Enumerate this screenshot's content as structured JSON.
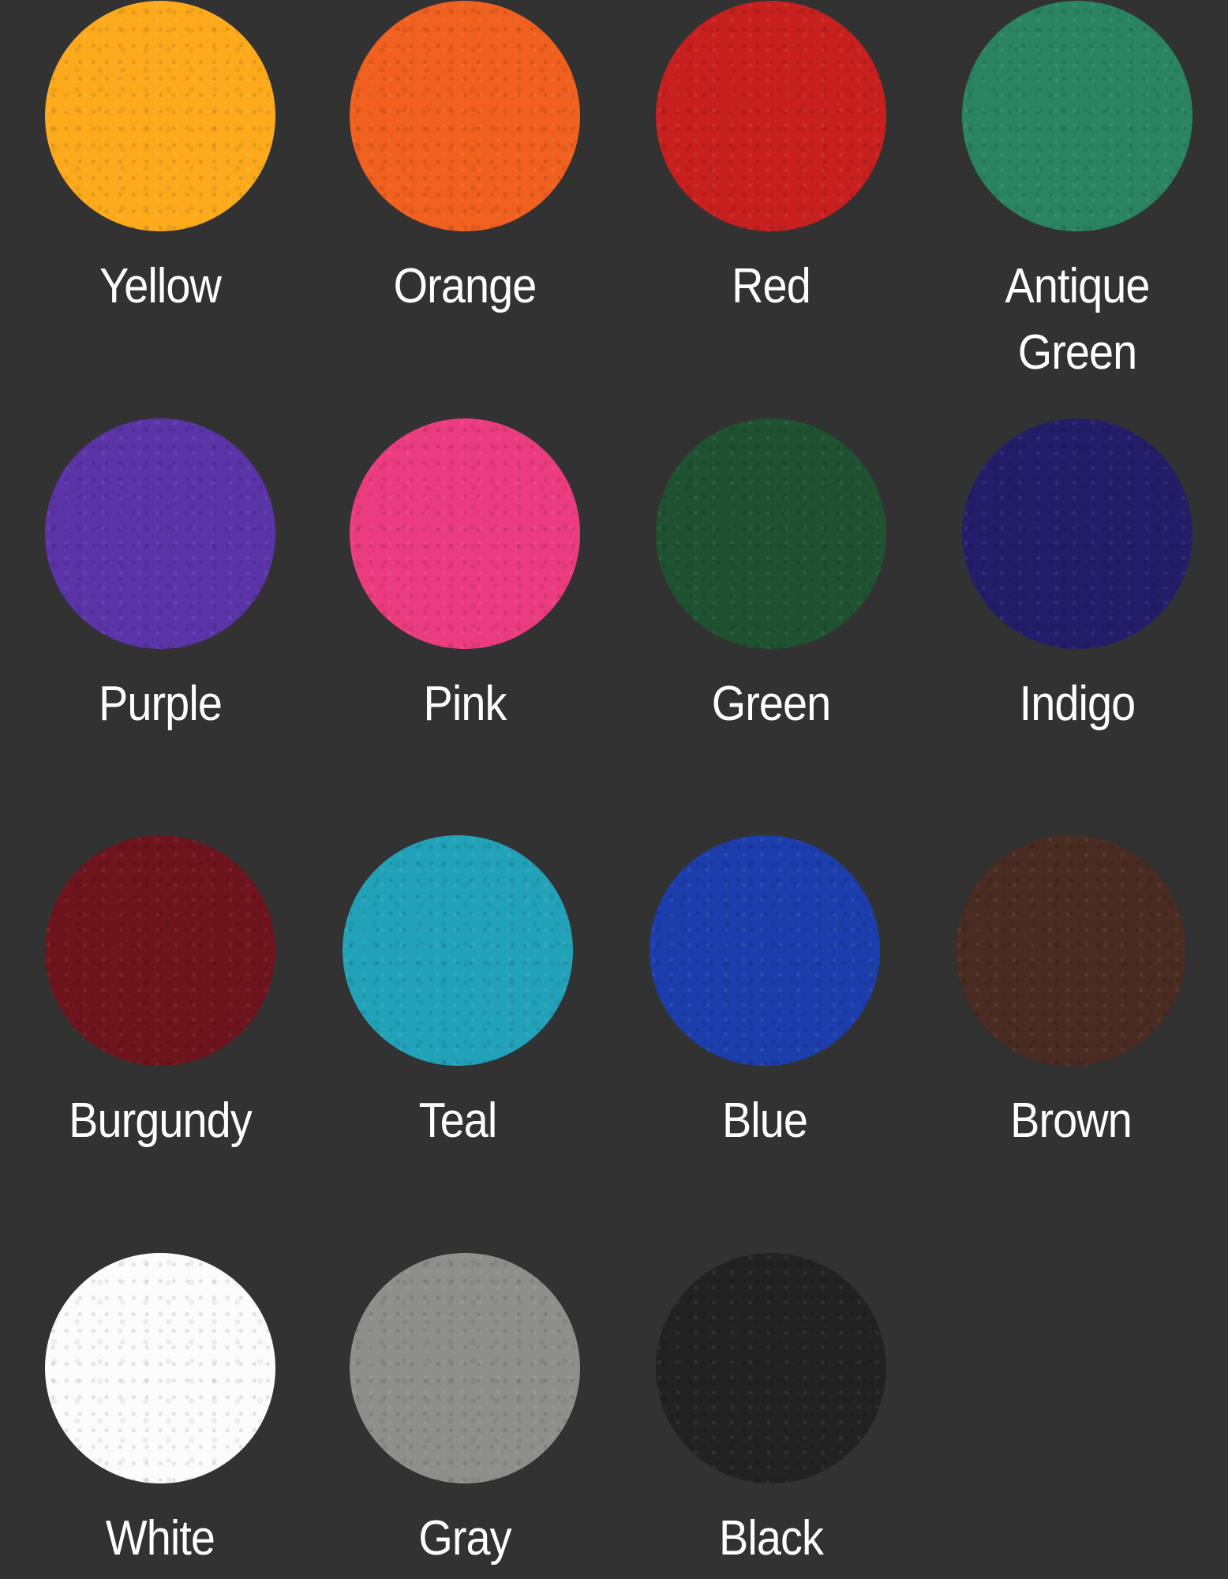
{
  "background_color": "#323232",
  "label_color": "#ffffff",
  "swatches": [
    {
      "name": "Yellow",
      "color": "#FCAA1C"
    },
    {
      "name": "Orange",
      "color": "#F0601E"
    },
    {
      "name": "Red",
      "color": "#C8201E"
    },
    {
      "name": "Antique Green",
      "label": "Antique\nGreen",
      "color": "#2A8462"
    },
    {
      "name": "Purple",
      "color": "#5B34A8"
    },
    {
      "name": "Pink",
      "color": "#EC3C80"
    },
    {
      "name": "Green",
      "color": "#1E5230"
    },
    {
      "name": "Indigo",
      "color": "#241E6A"
    },
    {
      "name": "Burgundy",
      "color": "#6E141C"
    },
    {
      "name": "Teal",
      "color": "#22A2B8"
    },
    {
      "name": "Blue",
      "color": "#1C3EAC"
    },
    {
      "name": "Brown",
      "color": "#4A2C22"
    },
    {
      "name": "White",
      "color": "#FCFCFC"
    },
    {
      "name": "Gray",
      "color": "#8E8E8C"
    },
    {
      "name": "Black",
      "color": "#222222"
    }
  ]
}
